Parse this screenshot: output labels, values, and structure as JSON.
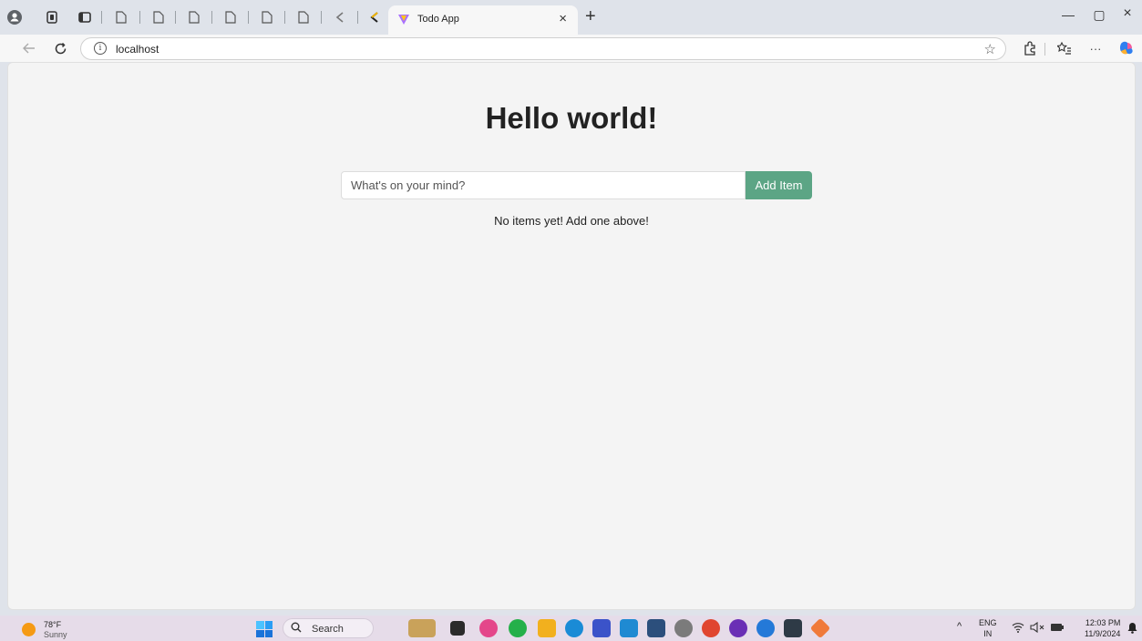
{
  "browser": {
    "active_tab_title": "Todo App",
    "new_tab_label": "+",
    "close_tab_label": "×",
    "url": "localhost",
    "window_controls": {
      "minimize": "—",
      "restore": "▢",
      "close": "×"
    },
    "toolbar_more": "···"
  },
  "page": {
    "title": "Hello world!",
    "input_placeholder": "What's on your mind?",
    "input_value": "",
    "add_button_label": "Add Item",
    "empty_message": "No items yet! Add one above!"
  },
  "taskbar": {
    "weather_temp": "78°F",
    "weather_condition": "Sunny",
    "search_label": "Search",
    "language_top": "ENG",
    "language_bottom": "IN",
    "time": "12:03 PM",
    "date": "11/9/2024"
  },
  "colors": {
    "accent_button": "#5ca585",
    "page_background": "#f4f4f4",
    "tab_strip": "#dfe3ea",
    "taskbar": "#e6dce9"
  },
  "icons": [
    "profile-icon",
    "workspaces-icon",
    "tab-actions-icon",
    "page-icon",
    "back-icon",
    "reload-icon",
    "info-icon",
    "favorites-star-icon",
    "extensions-icon",
    "collections-icon",
    "more-icon",
    "copilot-icon",
    "search-icon",
    "windows-start-icon",
    "notification-bell-icon",
    "wifi-icon",
    "volume-muted-icon",
    "battery-icon"
  ]
}
